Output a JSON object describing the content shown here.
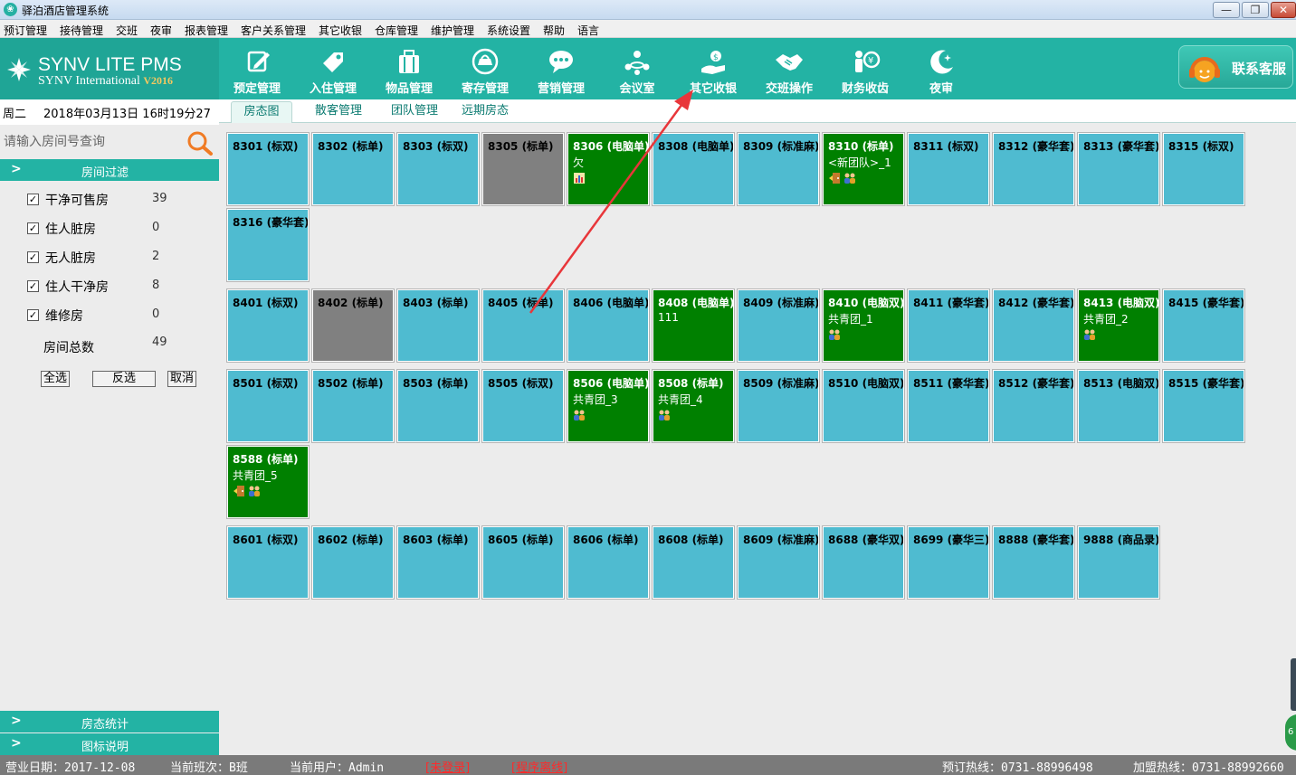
{
  "window": {
    "title": "驿泊酒店管理系统",
    "min": "—",
    "max": "❐",
    "close": "✕"
  },
  "menu": [
    "预订管理",
    "接待管理",
    "交班",
    "夜审",
    "报表管理",
    "客户关系管理",
    "其它收银",
    "仓库管理",
    "维护管理",
    "系统设置",
    "帮助",
    "语言"
  ],
  "logo": {
    "line1": "SYNV LITE PMS",
    "line2": "SYNV International",
    "version": "V2016"
  },
  "toolbar": [
    {
      "label": "预定管理",
      "icon": "edit-icon"
    },
    {
      "label": "入住管理",
      "icon": "tag-icon"
    },
    {
      "label": "物品管理",
      "icon": "suitcase-icon"
    },
    {
      "label": "寄存管理",
      "icon": "bag-icon"
    },
    {
      "label": "营销管理",
      "icon": "chat-icon"
    },
    {
      "label": "会议室",
      "icon": "meeting-icon"
    },
    {
      "label": "其它收银",
      "icon": "cashier-icon"
    },
    {
      "label": "交班操作",
      "icon": "handshake-icon"
    },
    {
      "label": "财务收齿",
      "icon": "finance-icon"
    },
    {
      "label": "夜审",
      "icon": "moon-icon"
    }
  ],
  "contact": {
    "label": "联系客服",
    "icon": "headset-icon"
  },
  "sidebar": {
    "weekday": "周二",
    "datetime": "2018年03月13日 16时19分27",
    "search_placeholder": "请输入房间号查询",
    "filter_title": "房间过滤",
    "filters": [
      {
        "label": "干净可售房",
        "count": "39",
        "checked": true
      },
      {
        "label": "住人脏房",
        "count": "0",
        "checked": true
      },
      {
        "label": "无人脏房",
        "count": "2",
        "checked": true
      },
      {
        "label": "住人干净房",
        "count": "8",
        "checked": true
      },
      {
        "label": "维修房",
        "count": "0",
        "checked": true
      }
    ],
    "total_label": "房间总数",
    "total_count": "49",
    "btn_all": "全选",
    "btn_invert": "反选",
    "btn_cancel": "取消",
    "stats_title": "房态统计",
    "legend_title": "图标说明"
  },
  "tabs": [
    "房态图",
    "散客管理",
    "团队管理",
    "远期房态"
  ],
  "rooms": [
    [
      {
        "name": "8301 (标双)",
        "status": "vacant"
      },
      {
        "name": "8302 (标单)",
        "status": "vacant"
      },
      {
        "name": "8303 (标双)",
        "status": "vacant"
      },
      {
        "name": "8305 (标单)",
        "status": "repair"
      },
      {
        "name": "8306 (电脑单)",
        "status": "occupied",
        "sub": "欠",
        "icons": [
          "bill-icon"
        ]
      },
      {
        "name": "8308 (电脑单)",
        "status": "vacant"
      },
      {
        "name": "8309 (标准麻)",
        "status": "vacant"
      },
      {
        "name": "8310 (标单)",
        "status": "occupied",
        "sub": "<新团队>_1",
        "icons": [
          "checkout-icon",
          "guests-icon"
        ]
      },
      {
        "name": "8311 (标双)",
        "status": "vacant"
      },
      {
        "name": "8312 (豪华套)",
        "status": "vacant"
      },
      {
        "name": "8313 (豪华套)",
        "status": "vacant"
      },
      {
        "name": "8315 (标双)",
        "status": "vacant"
      },
      {
        "name": "8316 (豪华套)",
        "status": "vacant"
      }
    ],
    [
      {
        "name": "8401 (标双)",
        "status": "vacant"
      },
      {
        "name": "8402 (标单)",
        "status": "repair"
      },
      {
        "name": "8403 (标单)",
        "status": "vacant"
      },
      {
        "name": "8405 (标单)",
        "status": "vacant"
      },
      {
        "name": "8406 (电脑单)",
        "status": "vacant"
      },
      {
        "name": "8408 (电脑单)",
        "status": "occupied",
        "sub": "111"
      },
      {
        "name": "8409 (标准麻)",
        "status": "vacant"
      },
      {
        "name": "8410 (电脑双)",
        "status": "occupied",
        "sub": "共青团_1",
        "icons": [
          "guests-icon"
        ]
      },
      {
        "name": "8411 (豪华套)",
        "status": "vacant"
      },
      {
        "name": "8412 (豪华套)",
        "status": "vacant"
      },
      {
        "name": "8413 (电脑双)",
        "status": "occupied",
        "sub": "共青团_2",
        "icons": [
          "guests-icon"
        ]
      },
      {
        "name": "8415 (豪华套)",
        "status": "vacant"
      }
    ],
    [
      {
        "name": "8501 (标双)",
        "status": "vacant"
      },
      {
        "name": "8502 (标单)",
        "status": "vacant"
      },
      {
        "name": "8503 (标单)",
        "status": "vacant"
      },
      {
        "name": "8505 (标双)",
        "status": "vacant"
      },
      {
        "name": "8506 (电脑单)",
        "status": "occupied",
        "sub": "共青团_3",
        "icons": [
          "guests-icon"
        ]
      },
      {
        "name": "8508 (标单)",
        "status": "occupied",
        "sub": "共青团_4",
        "icons": [
          "guests-icon"
        ]
      },
      {
        "name": "8509 (标准麻)",
        "status": "vacant"
      },
      {
        "name": "8510 (电脑双)",
        "status": "vacant"
      },
      {
        "name": "8511 (豪华套)",
        "status": "vacant"
      },
      {
        "name": "8512 (豪华套)",
        "status": "vacant"
      },
      {
        "name": "8513 (电脑双)",
        "status": "vacant"
      },
      {
        "name": "8515 (豪华套)",
        "status": "vacant"
      },
      {
        "name": "8588 (标单)",
        "status": "occupied",
        "sub": "共青团_5",
        "icons": [
          "checkout-icon",
          "guests-icon"
        ]
      }
    ],
    [
      {
        "name": "8601 (标双)",
        "status": "vacant"
      },
      {
        "name": "8602 (标单)",
        "status": "vacant"
      },
      {
        "name": "8603 (标单)",
        "status": "vacant"
      },
      {
        "name": "8605 (标单)",
        "status": "vacant"
      },
      {
        "name": "8606 (标单)",
        "status": "vacant"
      },
      {
        "name": "8608 (标单)",
        "status": "vacant"
      },
      {
        "name": "8609 (标准麻)",
        "status": "vacant"
      },
      {
        "name": "8688 (豪华双)",
        "status": "vacant"
      },
      {
        "name": "8699 (豪华三)",
        "status": "vacant"
      },
      {
        "name": "8888 (豪华套)",
        "status": "vacant"
      },
      {
        "name": "9888 (商品录)",
        "status": "vacant"
      }
    ]
  ],
  "status": {
    "biz_date": "营业日期：2017-12-08",
    "shift": "当前班次：B班",
    "user": "当前用户：Admin",
    "not_logged": "[未登录]",
    "offline": "[程序离线]",
    "booking_hotline": "预订热线：0731-88996498",
    "join_hotline": "加盟热线：0731-88992660"
  },
  "badge": "6",
  "colors": {
    "teal": "#23b3a4",
    "vacant": "#4fbbd0",
    "occupied": "#008000",
    "repair": "#808080",
    "annotation": "#e8363a"
  }
}
